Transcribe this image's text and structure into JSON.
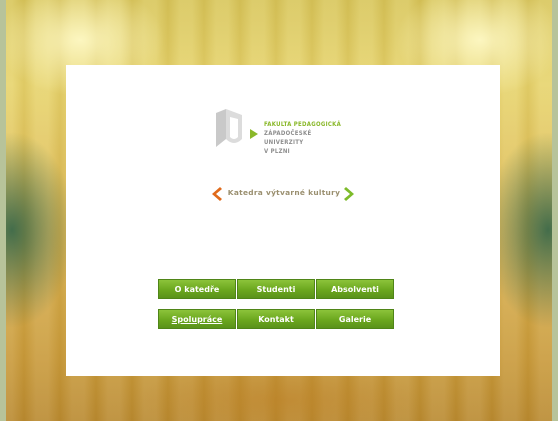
{
  "logo": {
    "lines": [
      "FAKULTA PEDAGOGICKÁ",
      "ZÁPADOČESKÉ",
      "UNIVERZITY",
      "V PLZNI"
    ],
    "colors": {
      "accent": "#8ab82a",
      "mark": "#c8c8c8"
    }
  },
  "department": {
    "label": "Katedra výtvarné kultury",
    "left_chevron_color": "#e06a1b",
    "right_chevron_color": "#7dbb2a"
  },
  "menu": {
    "rows": [
      [
        "O katedře",
        "Studenti",
        "Absolventi"
      ],
      [
        "Spolupráce",
        "Kontakt",
        "Galerie"
      ]
    ],
    "button_color": "#6ba71e"
  }
}
